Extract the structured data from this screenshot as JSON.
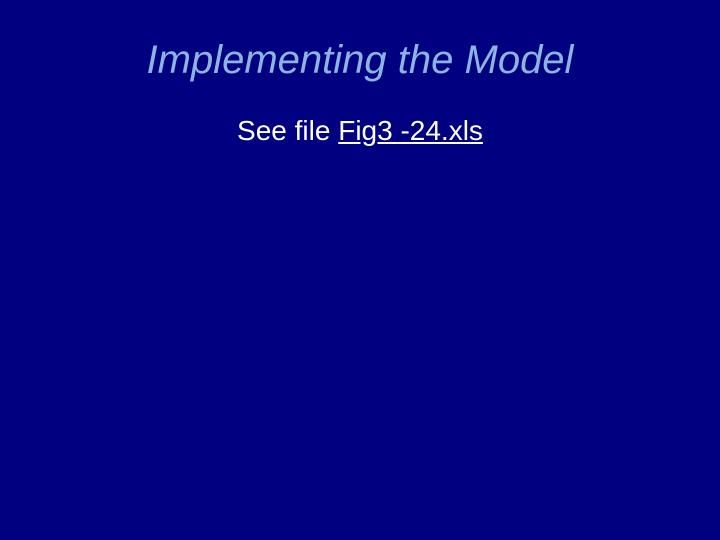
{
  "slide": {
    "title": "Implementing the Model",
    "body_prefix": "See file ",
    "filename": "Fig3 -24.xls"
  }
}
